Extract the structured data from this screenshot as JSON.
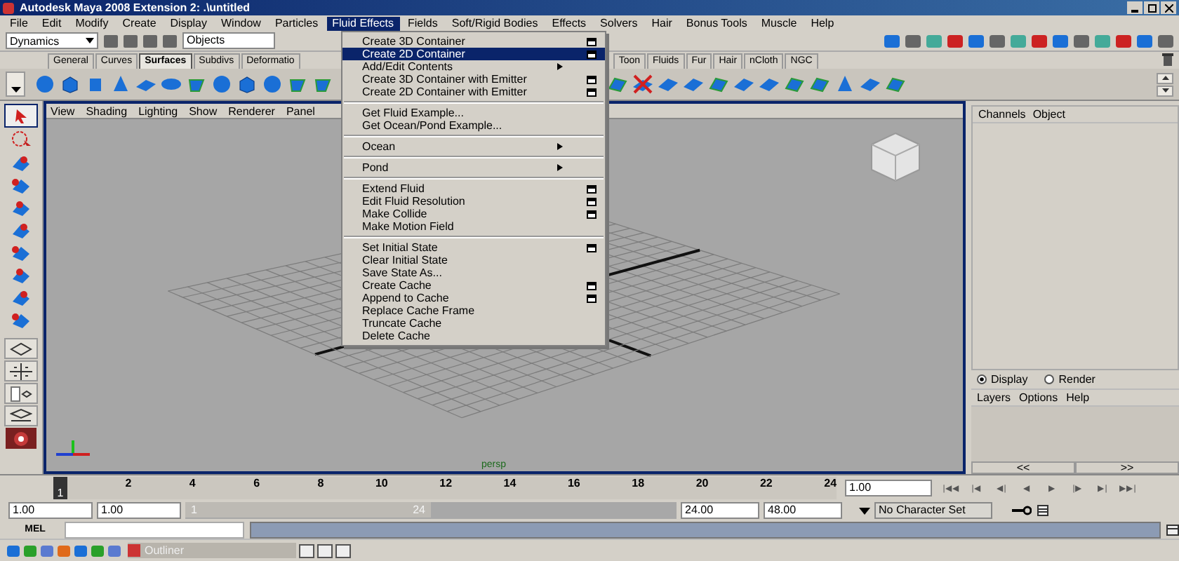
{
  "window": {
    "title": "Autodesk Maya 2008 Extension 2: .\\untitled"
  },
  "menu_bar": [
    {
      "label": "File",
      "selected": false
    },
    {
      "label": "Edit",
      "selected": false
    },
    {
      "label": "Modify",
      "selected": false
    },
    {
      "label": "Create",
      "selected": false
    },
    {
      "label": "Display",
      "selected": false
    },
    {
      "label": "Window",
      "selected": false
    },
    {
      "label": "Particles",
      "selected": false
    },
    {
      "label": "Fluid Effects",
      "selected": true
    },
    {
      "label": "Fields",
      "selected": false
    },
    {
      "label": "Soft/Rigid Bodies",
      "selected": false
    },
    {
      "label": "Effects",
      "selected": false
    },
    {
      "label": "Solvers",
      "selected": false
    },
    {
      "label": "Hair",
      "selected": false
    },
    {
      "label": "Bonus Tools",
      "selected": false
    },
    {
      "label": "Muscle",
      "selected": false
    },
    {
      "label": "Help",
      "selected": false
    }
  ],
  "status_line": {
    "mode": "Dynamics",
    "selection_mask": "Objects"
  },
  "shelf_tabs": [
    {
      "label": "General",
      "selected": false
    },
    {
      "label": "Curves",
      "selected": false
    },
    {
      "label": "Surfaces",
      "selected": true
    },
    {
      "label": "Subdivs",
      "selected": false
    },
    {
      "label": "Deformatio",
      "selected": false
    },
    {
      "label": "Toon",
      "selected": false
    },
    {
      "label": "Fluids",
      "selected": false
    },
    {
      "label": "Fur",
      "selected": false
    },
    {
      "label": "Hair",
      "selected": false
    },
    {
      "label": "nCloth",
      "selected": false
    },
    {
      "label": "NGC",
      "selected": false
    }
  ],
  "fluid_menu": [
    {
      "kind": "item",
      "label": "Create 3D Container",
      "option_box": true,
      "selected": false
    },
    {
      "kind": "item",
      "label": "Create 2D Container",
      "option_box": true,
      "selected": true
    },
    {
      "kind": "submenu",
      "label": "Add/Edit Contents",
      "option_box": false,
      "selected": false
    },
    {
      "kind": "item",
      "label": "Create 3D Container with Emitter",
      "option_box": true,
      "selected": false
    },
    {
      "kind": "item",
      "label": "Create 2D Container with Emitter",
      "option_box": true,
      "selected": false
    },
    {
      "kind": "separator"
    },
    {
      "kind": "item",
      "label": "Get Fluid Example...",
      "option_box": false,
      "selected": false
    },
    {
      "kind": "item",
      "label": "Get Ocean/Pond Example...",
      "option_box": false,
      "selected": false
    },
    {
      "kind": "separator"
    },
    {
      "kind": "submenu",
      "label": "Ocean",
      "option_box": false,
      "selected": false
    },
    {
      "kind": "separator"
    },
    {
      "kind": "submenu",
      "label": "Pond",
      "option_box": false,
      "selected": false
    },
    {
      "kind": "separator"
    },
    {
      "kind": "item",
      "label": "Extend Fluid",
      "option_box": true,
      "selected": false
    },
    {
      "kind": "item",
      "label": "Edit Fluid Resolution",
      "option_box": true,
      "selected": false
    },
    {
      "kind": "item",
      "label": "Make Collide",
      "option_box": true,
      "selected": false
    },
    {
      "kind": "item",
      "label": "Make Motion Field",
      "option_box": false,
      "selected": false
    },
    {
      "kind": "separator"
    },
    {
      "kind": "item",
      "label": "Set Initial State",
      "option_box": true,
      "selected": false
    },
    {
      "kind": "item",
      "label": "Clear Initial State",
      "option_box": false,
      "selected": false
    },
    {
      "kind": "item",
      "label": "Save State As...",
      "option_box": false,
      "selected": false
    },
    {
      "kind": "item",
      "label": "Create Cache",
      "option_box": true,
      "selected": false
    },
    {
      "kind": "item",
      "label": "Append to Cache",
      "option_box": true,
      "selected": false
    },
    {
      "kind": "item",
      "label": "Replace Cache Frame",
      "option_box": false,
      "selected": false
    },
    {
      "kind": "item",
      "label": "Truncate Cache",
      "option_box": false,
      "selected": false
    },
    {
      "kind": "item",
      "label": "Delete Cache",
      "option_box": false,
      "selected": false
    }
  ],
  "panel_menu": [
    "View",
    "Shading",
    "Lighting",
    "Show",
    "Renderer",
    "Panel"
  ],
  "viewport": {
    "camera": "persp"
  },
  "channel_box": {
    "menu": [
      "Channels",
      "Object"
    ]
  },
  "layer_editor": {
    "nav": [
      "<<",
      ">>"
    ],
    "modes": [
      {
        "label": "Display",
        "selected": true
      },
      {
        "label": "Render",
        "selected": false
      }
    ],
    "menu": [
      "Layers",
      "Options",
      "Help"
    ]
  },
  "time_slider": {
    "level": 0,
    "current_frame": "1",
    "ticks": [
      "2",
      "4",
      "6",
      "8",
      "10",
      "12",
      "14",
      "16",
      "18",
      "20",
      "22",
      "24"
    ],
    "current_time": "1.00",
    "playback": [
      "|◀◀",
      "|◀",
      "◀|",
      "◀",
      "▶",
      "|▶",
      "▶|",
      "▶▶|"
    ]
  },
  "range_slider": {
    "level": 0.5,
    "start": "1.00",
    "playback_start": "1.00",
    "range_start": "1",
    "range_end": "24",
    "playback_end": "24.00",
    "end": "48.00",
    "character_set": "No Character Set"
  },
  "command_line": {
    "label": "MEL"
  },
  "taskbar": {
    "windows": [
      "Outliner"
    ]
  }
}
